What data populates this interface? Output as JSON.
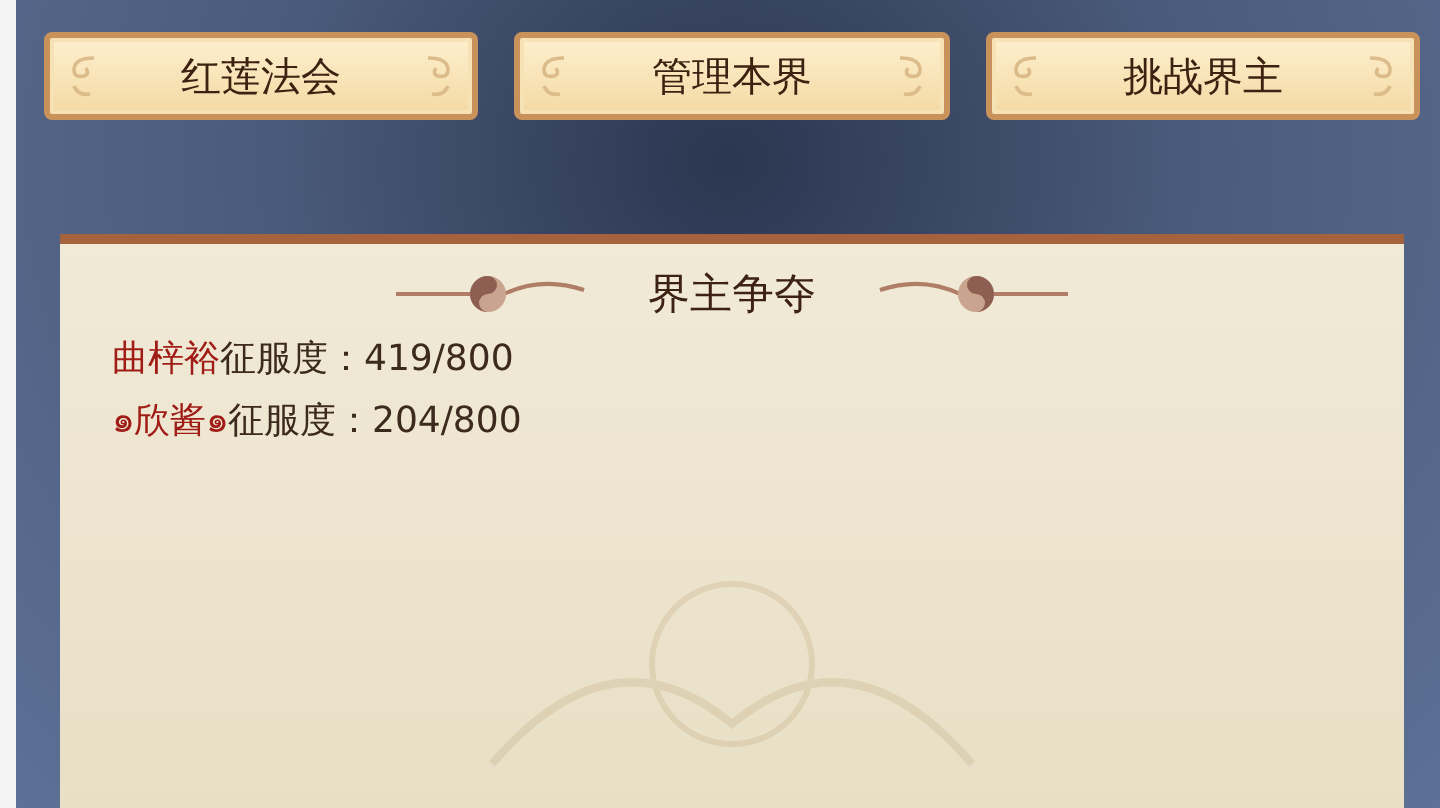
{
  "buttons": [
    {
      "label": "红莲法会"
    },
    {
      "label": "管理本界"
    },
    {
      "label": "挑战界主"
    }
  ],
  "panel": {
    "title": "界主争夺",
    "rows": [
      {
        "name": "曲梓裕",
        "stat": "征服度：419/800"
      },
      {
        "name": "๑欣酱๑",
        "stat": "征服度：204/800"
      }
    ]
  }
}
